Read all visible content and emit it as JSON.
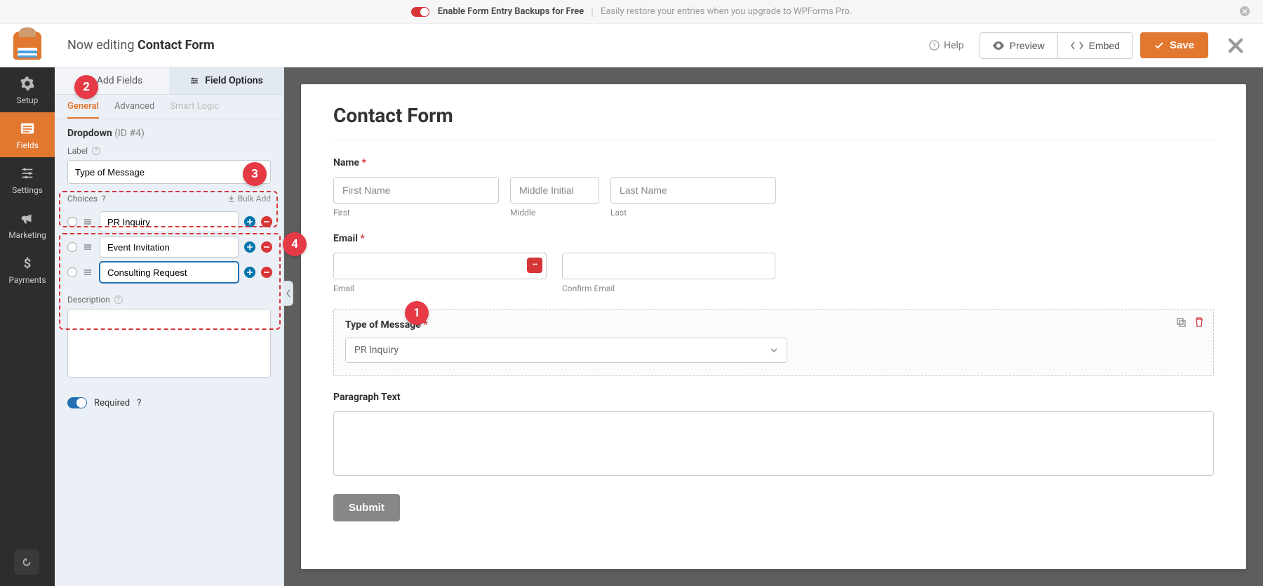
{
  "banner": {
    "title": "Enable Form Entry Backups for Free",
    "subtitle": "Easily restore your entries when you upgrade to WPForms Pro."
  },
  "header": {
    "editing_prefix": "Now editing ",
    "form_name": "Contact Form",
    "help": "Help",
    "preview": "Preview",
    "embed": "Embed",
    "save": "Save"
  },
  "nav": {
    "setup": "Setup",
    "fields": "Fields",
    "settings": "Settings",
    "marketing": "Marketing",
    "payments": "Payments"
  },
  "panel": {
    "tab_add": "Add Fields",
    "tab_options": "Field Options",
    "sub_general": "General",
    "sub_advanced": "Advanced",
    "sub_smart": "Smart Logic",
    "field_type": "Dropdown",
    "field_id": "(ID #4)",
    "label_label": "Label",
    "label_value": "Type of Message",
    "choices_label": "Choices",
    "bulk_add": "Bulk Add",
    "choices": [
      "PR Inquiry",
      "Event Invitation",
      "Consulting Request"
    ],
    "description_label": "Description",
    "required_label": "Required"
  },
  "form": {
    "title": "Contact Form",
    "name_label": "Name",
    "first_ph": "First Name",
    "middle_ph": "Middle Initial",
    "last_ph": "Last Name",
    "first_sub": "First",
    "middle_sub": "Middle",
    "last_sub": "Last",
    "email_label": "Email",
    "email_sub": "Email",
    "confirm_sub": "Confirm Email",
    "type_label": "Type of Message",
    "type_selected": "PR Inquiry",
    "paragraph_label": "Paragraph Text",
    "submit": "Submit"
  },
  "annotations": [
    "1",
    "2",
    "3",
    "4"
  ]
}
